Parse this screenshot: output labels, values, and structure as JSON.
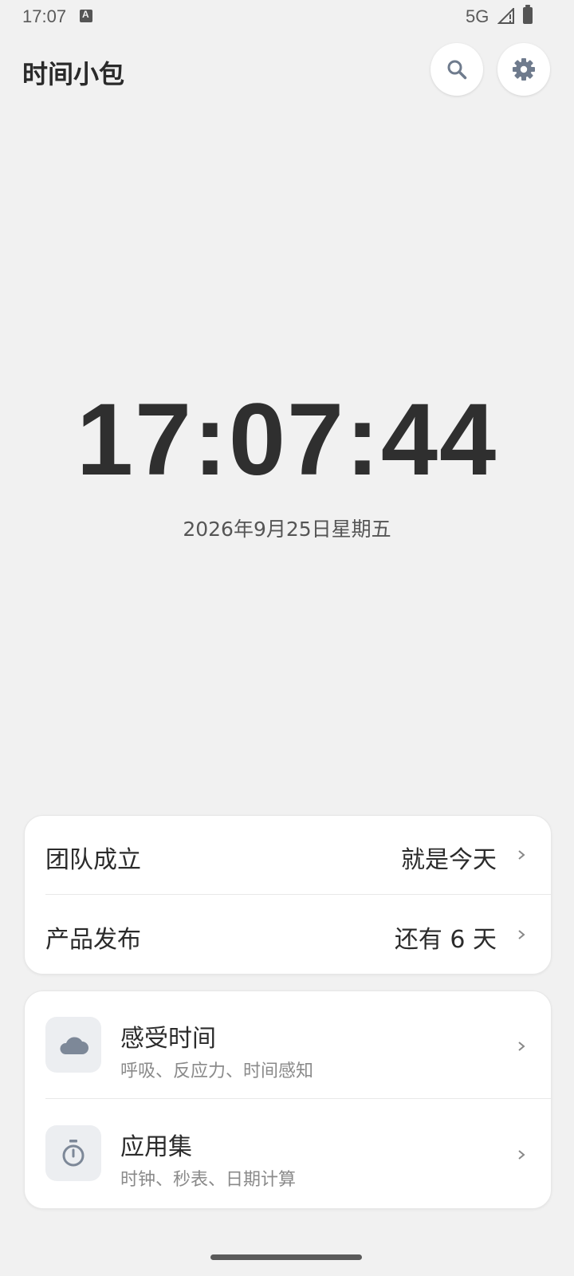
{
  "status_bar": {
    "time": "17:07",
    "network": "5G"
  },
  "header": {
    "title": "时间小包",
    "search_icon": "search-icon",
    "settings_icon": "gear-icon"
  },
  "clock": {
    "time": "17:07:44",
    "date": "2026年9月25日星期五"
  },
  "events": [
    {
      "name": "团队成立",
      "value": "就是今天"
    },
    {
      "name": "产品发布",
      "value": "还有 6 天"
    }
  ],
  "apps": [
    {
      "title": "感受时间",
      "subtitle": "呼吸、反应力、时间感知",
      "icon": "cloud-icon"
    },
    {
      "title": "应用集",
      "subtitle": "时钟、秒表、日期计算",
      "icon": "stopwatch-icon"
    }
  ],
  "colors": {
    "background": "#f1f1f1",
    "icon_accent": "#7d8898",
    "text": "#2b2b2b"
  }
}
